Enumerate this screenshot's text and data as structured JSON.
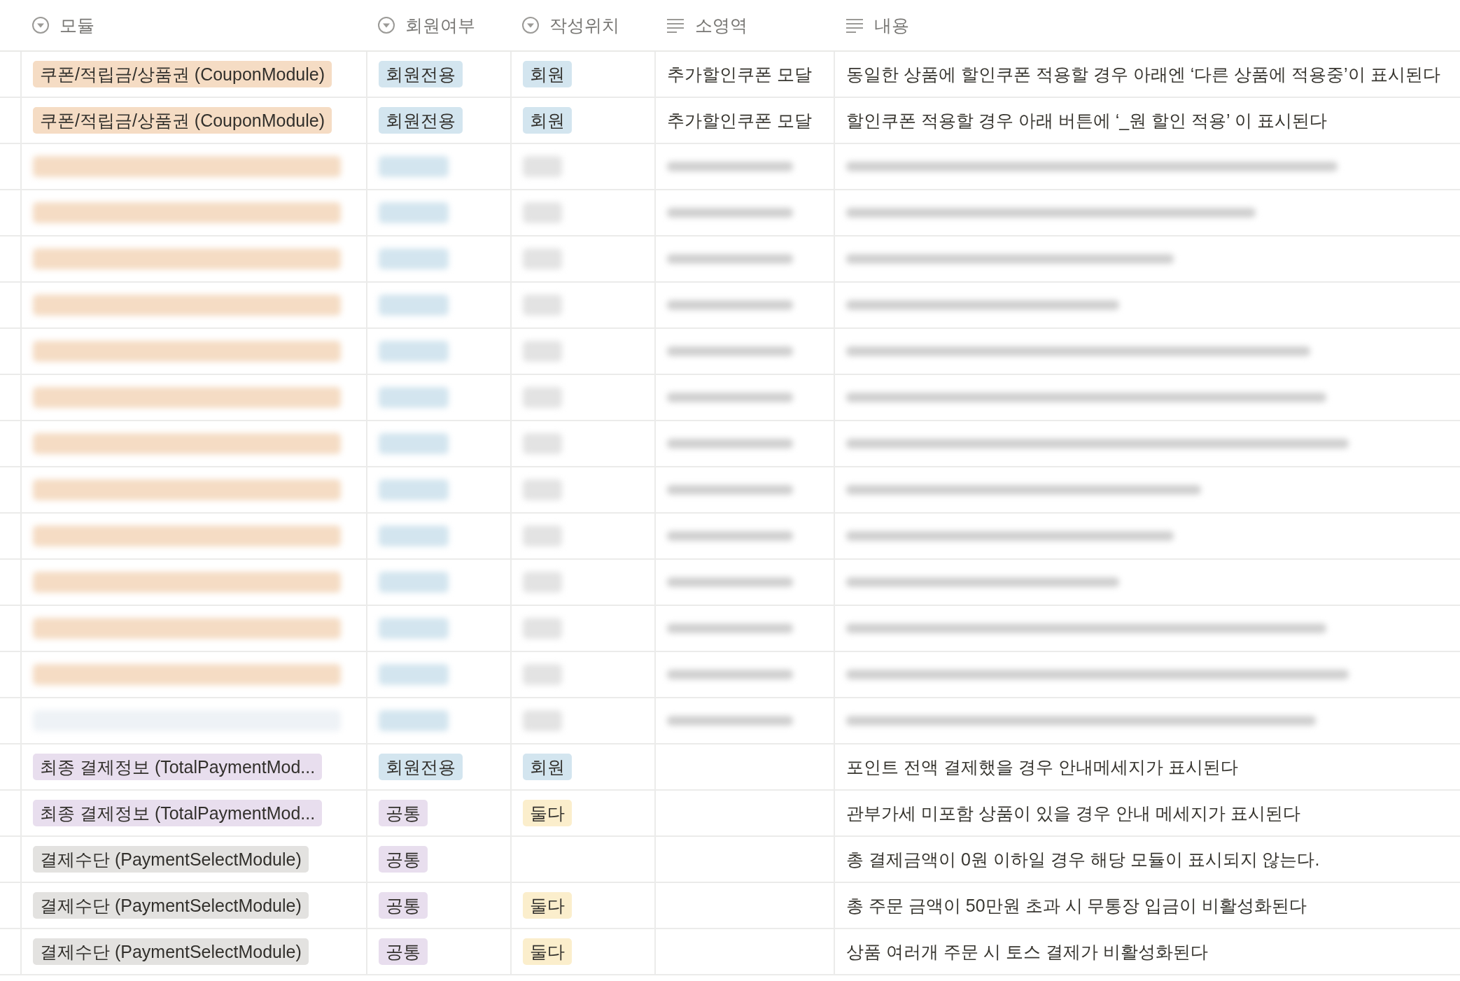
{
  "columns": [
    {
      "label": "모듈",
      "kind": "select"
    },
    {
      "label": "회원여부",
      "kind": "select"
    },
    {
      "label": "작성위치",
      "kind": "select"
    },
    {
      "label": "소영역",
      "kind": "text"
    },
    {
      "label": "내용",
      "kind": "text"
    }
  ],
  "rows": [
    {
      "kind": "row",
      "module": {
        "text": "쿠폰/적립금/상품권 (CouponModule)",
        "color": "#f5dcc4"
      },
      "member": {
        "text": "회원전용",
        "color": "#d3e5ef"
      },
      "location": {
        "text": "회원",
        "color": "#d3e5ef"
      },
      "area": "추가할인쿠폰 모달",
      "content": "동일한 상품에 할인쿠폰 적용할 경우 아래엔 ‘다른 상품에 적용중’이 표시된다"
    },
    {
      "kind": "row",
      "module": {
        "text": "쿠폰/적립금/상품권 (CouponModule)",
        "color": "#f5dcc4"
      },
      "member": {
        "text": "회원전용",
        "color": "#d3e5ef"
      },
      "location": {
        "text": "회원",
        "color": "#d3e5ef"
      },
      "area": "추가할인쿠폰 모달",
      "content": "할인쿠폰 적용할 경우 아래 버튼에 ‘_원 할인 적용’ 이 표시된다"
    },
    {
      "kind": "blurred",
      "color": "#f5dcc4"
    },
    {
      "kind": "blurred",
      "color": "#f5dcc4"
    },
    {
      "kind": "blurred",
      "color": "#f5dcc4"
    },
    {
      "kind": "blurred",
      "color": "#f5dcc4"
    },
    {
      "kind": "blurred",
      "color": "#f5dcc4"
    },
    {
      "kind": "blurred",
      "color": "#f5dcc4"
    },
    {
      "kind": "blurred",
      "color": "#f5dcc4"
    },
    {
      "kind": "blurred",
      "color": "#f5dcc4"
    },
    {
      "kind": "blurred",
      "color": "#f5dcc4"
    },
    {
      "kind": "blurred",
      "color": "#f5dcc4"
    },
    {
      "kind": "blurred",
      "color": "#f5dcc4"
    },
    {
      "kind": "blurred",
      "color": "#f5dcc4"
    },
    {
      "kind": "blurred",
      "color": "#eef2f6"
    },
    {
      "kind": "row",
      "module": {
        "text": "최종 결제정보 (TotalPaymentMod...",
        "color": "#e8deee"
      },
      "member": {
        "text": "회원전용",
        "color": "#d3e5ef"
      },
      "location": {
        "text": "회원",
        "color": "#d3e5ef"
      },
      "content": "포인트 전액 결제했을 경우 안내메세지가 표시된다"
    },
    {
      "kind": "row",
      "module": {
        "text": "최종 결제정보 (TotalPaymentMod...",
        "color": "#e8deee"
      },
      "member": {
        "text": "공통",
        "color": "#e8deee"
      },
      "location": {
        "text": "둘다",
        "color": "#fbeecc"
      },
      "content": "관부가세 미포함 상품이 있을 경우 안내 메세지가 표시된다"
    },
    {
      "kind": "row",
      "module": {
        "text": "결제수단 (PaymentSelectModule)",
        "color": "#e3e2e0"
      },
      "member": {
        "text": "공통",
        "color": "#e8deee"
      },
      "content": "총 결제금액이 0원 이하일 경우 해당 모듈이 표시되지 않는다."
    },
    {
      "kind": "row",
      "module": {
        "text": "결제수단 (PaymentSelectModule)",
        "color": "#e3e2e0"
      },
      "member": {
        "text": "공통",
        "color": "#e8deee"
      },
      "location": {
        "text": "둘다",
        "color": "#fbeecc"
      },
      "content": "총 주문 금액이 50만원 초과 시 무통장 입금이 비활성화된다"
    },
    {
      "kind": "row",
      "module": {
        "text": "결제수단 (PaymentSelectModule)",
        "color": "#e3e2e0"
      },
      "member": {
        "text": "공통",
        "color": "#e8deee"
      },
      "location": {
        "text": "둘다",
        "color": "#fbeecc"
      },
      "content": "상품 여러개 주문 시 토스 결제가 비활성화된다"
    }
  ]
}
